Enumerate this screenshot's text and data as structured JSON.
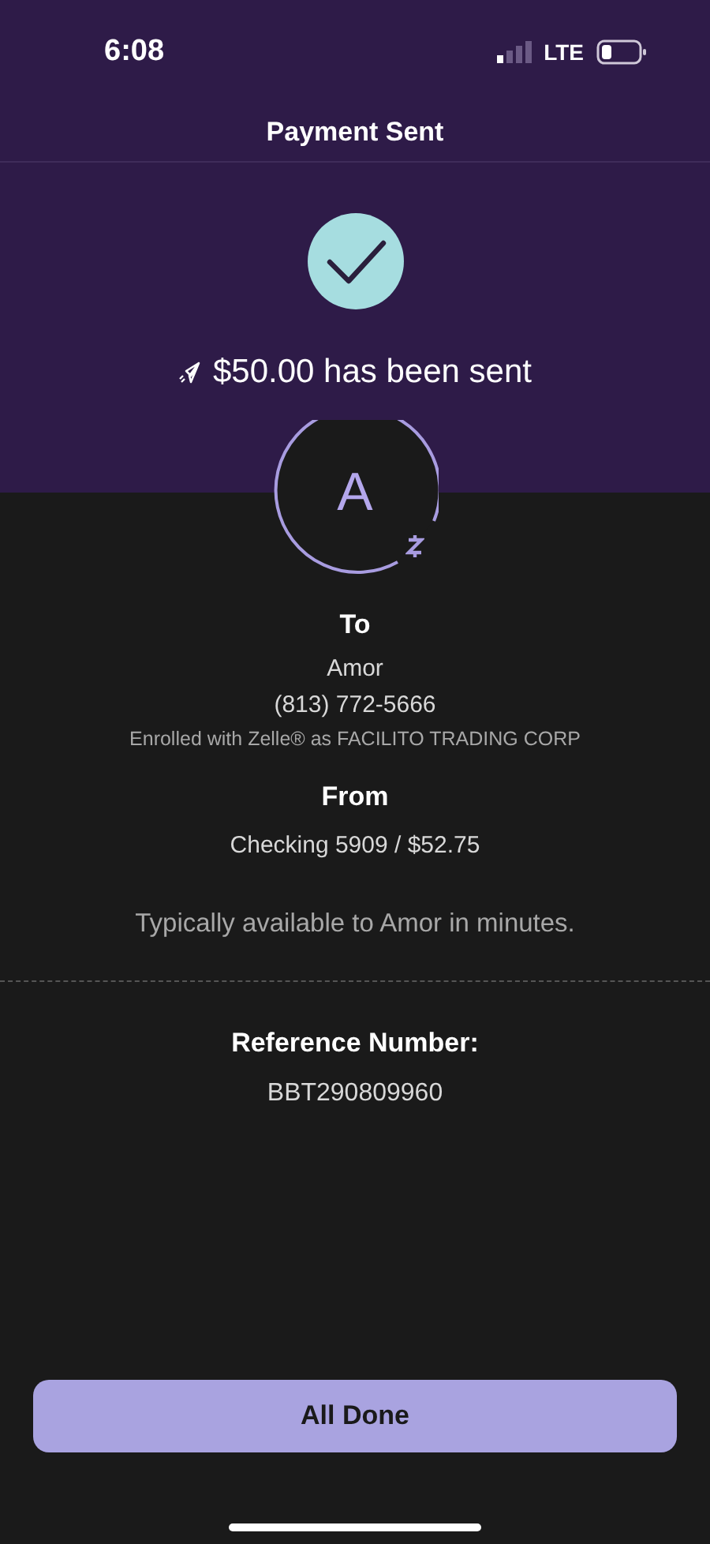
{
  "status_bar": {
    "time": "6:08",
    "network": "LTE"
  },
  "header": {
    "title": "Payment Sent"
  },
  "confirmation": {
    "message": "$50.00 has been sent"
  },
  "recipient": {
    "initial": "A",
    "heading": "To",
    "name": "Amor",
    "phone": "(813) 772-5666",
    "enrollment": "Enrolled with Zelle® as FACILITO TRADING CORP"
  },
  "sender": {
    "heading": "From",
    "account": "Checking 5909 / $52.75"
  },
  "availability_note": "Typically available to Amor in minutes.",
  "reference": {
    "label": "Reference Number:",
    "value": "BBT290809960"
  },
  "primary_button": {
    "label": "All Done"
  }
}
